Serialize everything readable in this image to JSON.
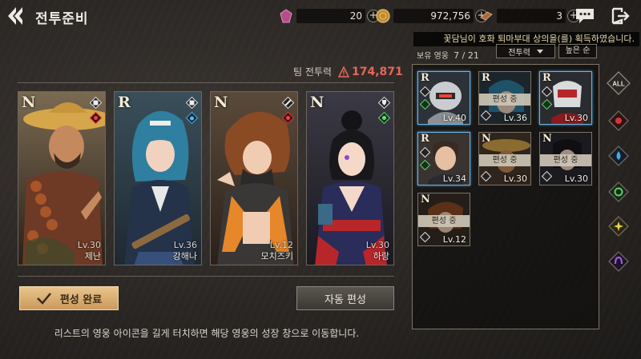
{
  "header": {
    "title": "전투준비",
    "resources": [
      {
        "icon": "crystal-icon",
        "value": "20"
      },
      {
        "icon": "gold-coin-icon",
        "value": "972,756"
      },
      {
        "icon": "ticket-icon",
        "value": "3"
      }
    ]
  },
  "notice": "꽃담님이 호화 퇴마부대 상의을(를) 획득하였습니다.",
  "team": {
    "label": "팀 전투력",
    "power": "174,871"
  },
  "cards": [
    {
      "rank": "N",
      "level": "Lv.30",
      "name": "제난",
      "element": "fire",
      "art": "straw-hat"
    },
    {
      "rank": "R",
      "level": "Lv.36",
      "name": "강해나",
      "element": "water",
      "art": "maid"
    },
    {
      "rank": "N",
      "level": "Lv.12",
      "name": "모치즈키",
      "element": "fire",
      "art": "ninja"
    },
    {
      "rank": "N",
      "level": "Lv.30",
      "name": "하랑",
      "element": "wind",
      "art": "hanbok"
    }
  ],
  "buttons": {
    "done": "편성 완료",
    "auto": "자동 편성"
  },
  "tip": "리스트의 영웅 아이콘을 길게 터치하면 해당 영웅의 성장 창으로 이동합니다.",
  "roster": {
    "owned_label": "보유 영웅",
    "owned_count": "7 / 21",
    "sort_label": "전투력",
    "order_label": "높은 순",
    "heroes": [
      {
        "rank": "R",
        "level": "Lv.40",
        "status": ""
      },
      {
        "rank": "R",
        "level": "Lv.36",
        "status": "편성 중"
      },
      {
        "rank": "R",
        "level": "Lv.30",
        "status": ""
      },
      {
        "rank": "R",
        "level": "Lv.34",
        "status": ""
      },
      {
        "rank": "N",
        "level": "Lv.30",
        "status": "편성 중"
      },
      {
        "rank": "N",
        "level": "Lv.30",
        "status": "편성 중"
      },
      {
        "rank": "N",
        "level": "Lv.12",
        "status": "편성 중"
      }
    ]
  },
  "filters": [
    "ALL",
    "fire",
    "water",
    "wind",
    "light",
    "dark"
  ],
  "colors": {
    "accent": "#e9c48c",
    "power": "#e4675a",
    "selected": "#6fb4e0"
  }
}
